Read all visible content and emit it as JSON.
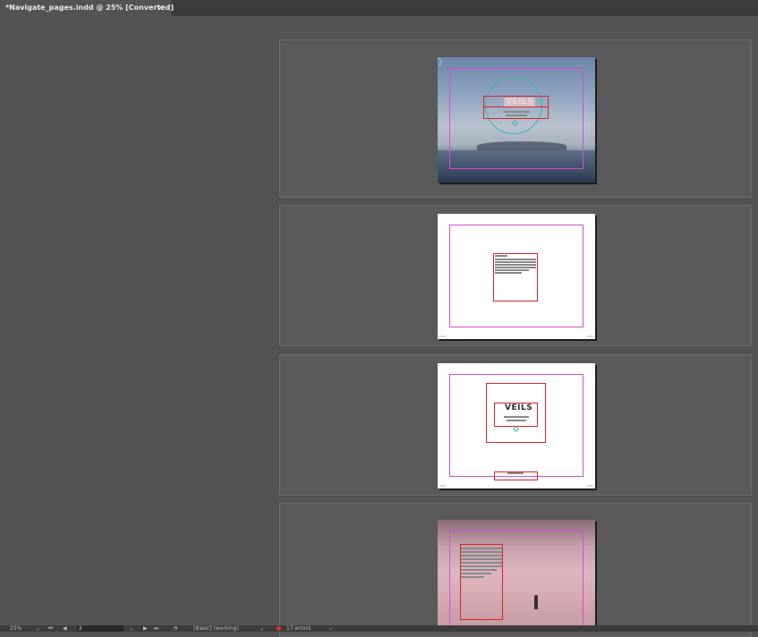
{
  "tab": {
    "title": "*Navigate_pages.indd @ 25% [Converted]",
    "close_glyph": "×"
  },
  "spreads": [
    {
      "name": "page-1",
      "text": "VEILS"
    },
    {
      "name": "page-2"
    },
    {
      "name": "page-3",
      "text": "VEILS"
    },
    {
      "name": "page-4"
    }
  ],
  "status": {
    "zoom": "25%",
    "page": "2",
    "style": "[Basic] (working)",
    "errors": "17 errors",
    "error_color": "#e0312a"
  }
}
